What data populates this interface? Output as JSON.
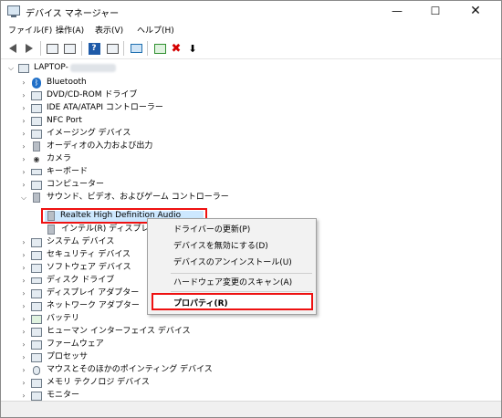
{
  "window": {
    "title": "デバイス マネージャー",
    "minimize": "—",
    "maximize": "☐",
    "close": "✕"
  },
  "menu": [
    "ファイル(F)",
    "操作(A)",
    "表示(V)",
    "ヘルプ(H)"
  ],
  "toolbar": {
    "icons": [
      "back-arrow-icon",
      "forward-arrow-icon",
      "properties-icon",
      "update-icon",
      "help-icon",
      "scan-icon",
      "monitor-icon",
      "enable-device-icon",
      "uninstall-icon",
      "download-icon"
    ],
    "uninstall_glyph": "✖",
    "download_glyph": "⬇"
  },
  "tree": {
    "root": "LAPTOP-",
    "items": [
      {
        "label": "Bluetooth",
        "icon": "bluetooth-icon"
      },
      {
        "label": "DVD/CD-ROM ドライブ",
        "icon": "dvd-drive-icon"
      },
      {
        "label": "IDE ATA/ATAPI コントローラー",
        "icon": "ide-controller-icon"
      },
      {
        "label": "NFC Port",
        "icon": "nfc-icon"
      },
      {
        "label": "イメージング デバイス",
        "icon": "imaging-icon"
      },
      {
        "label": "オーディオの入力および出力",
        "icon": "audio-io-icon"
      },
      {
        "label": "カメラ",
        "icon": "camera-icon"
      },
      {
        "label": "キーボード",
        "icon": "keyboard-icon"
      },
      {
        "label": "コンピューター",
        "icon": "computer-icon"
      },
      {
        "label": "サウンド、ビデオ、およびゲーム コントローラー",
        "icon": "sound-icon",
        "expanded": true
      },
      {
        "label": "Realtek High Definition Audio",
        "icon": "speaker-icon",
        "child": true,
        "selected": true
      },
      {
        "label": "インテル(R) ディスプレイ用",
        "icon": "speaker-icon",
        "child": true
      },
      {
        "label": "システム デバイス",
        "icon": "system-icon"
      },
      {
        "label": "セキュリティ デバイス",
        "icon": "security-icon"
      },
      {
        "label": "ソフトウェア デバイス",
        "icon": "software-icon"
      },
      {
        "label": "ディスク ドライブ",
        "icon": "disk-icon"
      },
      {
        "label": "ディスプレイ アダプター",
        "icon": "display-icon"
      },
      {
        "label": "ネットワーク アダプター",
        "icon": "network-icon"
      },
      {
        "label": "バッテリ",
        "icon": "battery-icon"
      },
      {
        "label": "ヒューマン インターフェイス デバイス",
        "icon": "hid-icon"
      },
      {
        "label": "ファームウェア",
        "icon": "firmware-icon"
      },
      {
        "label": "プロセッサ",
        "icon": "processor-icon"
      },
      {
        "label": "マウスとそのほかのポインティング デバイス",
        "icon": "mouse-icon"
      },
      {
        "label": "メモリ テクノロジ デバイス",
        "icon": "memory-icon"
      },
      {
        "label": "モニター",
        "icon": "monitor-icon"
      }
    ]
  },
  "context_menu": {
    "items": [
      "ドライバーの更新(P)",
      "デバイスを無効にする(D)",
      "デバイスのアンインストール(U)",
      "ハードウェア変更のスキャン(A)",
      "プロパティ(R)"
    ]
  },
  "colors": {
    "highlight_border": "#ee1111",
    "selection_fill": "#cde8ff"
  }
}
